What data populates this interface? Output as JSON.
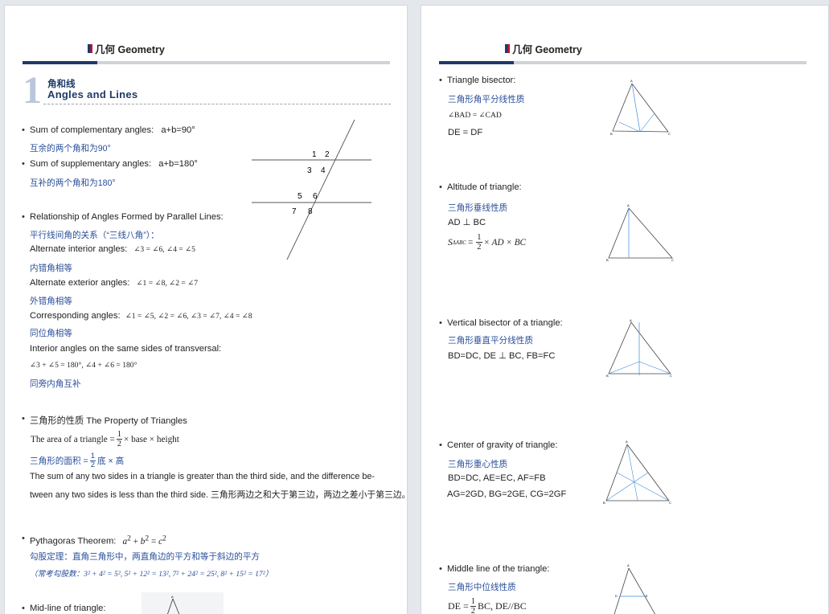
{
  "header": {
    "title": "几何 Geometry"
  },
  "left": {
    "section_number": "1",
    "section_title_cn": "角和线",
    "section_title_en": "Angles and Lines",
    "complementary": {
      "label": "Sum of complementary angles:",
      "formula": "a+b=90°",
      "cn": "互余的两个角和为90°"
    },
    "supplementary": {
      "label": "Sum of supplementary angles:",
      "formula": "a+b=180°",
      "cn": "互补的两个角和为180°"
    },
    "parallel": {
      "label": "Relationship of Angles Formed by Parallel Lines:",
      "cn": "平行线间角的关系（“三线八角”）：",
      "alt_interior_label": "Alternate interior angles:",
      "alt_interior_formula": "∠3 = ∠6, ∠4 = ∠5",
      "alt_interior_cn": "内错角相等",
      "alt_exterior_label": "Alternate exterior angles:",
      "alt_exterior_formula": "∠1 = ∠8, ∠2 = ∠7",
      "alt_exterior_cn": "外错角相等",
      "corresponding_label": "Corresponding angles:",
      "corresponding_formula": "∠1 = ∠5, ∠2 = ∠6, ∠3 = ∠7, ∠4 = ∠8",
      "corresponding_cn": "同位角相等",
      "interior_same_label": "Interior angles on the same sides of transversal:",
      "interior_same_formula": "∠3 + ∠5 = 180°, ∠4 + ∠6 = 180°",
      "interior_same_cn": "同旁内角互补",
      "angle_labels": [
        "1",
        "2",
        "3",
        "4",
        "5",
        "6",
        "7",
        "8"
      ]
    },
    "triangle_property": {
      "label": "三角形的性质 The Property of Triangles",
      "area_prefix": "The area of a triangle =",
      "area_num": "1",
      "area_den": "2",
      "area_suffix": "× base × height",
      "area_cn_prefix": "三角形的面积 =",
      "area_cn_num": "1",
      "area_cn_den": "2",
      "area_cn_suffix": "底 × 高",
      "sides_line1": "The sum of any two sides in a triangle is greater than the third side, and the difference be-",
      "sides_line2": "tween any two sides is less than the third side. 三角形两边之和大于第三边，两边之差小于第三边。"
    },
    "pythagoras": {
      "label": "Pythagoras Theorem:",
      "formula_a": "a",
      "formula_plus": " + ",
      "formula_b": "b",
      "formula_eq": " = ",
      "formula_c": "c",
      "exp": "2",
      "cn": "勾股定理：直角三角形中，两直角边的平方和等于斜边的平方",
      "examples": "（常考勾股数：3² + 4² = 5², 5² + 12² = 13², 7² + 24² = 25², 8² + 15² = 17²）"
    },
    "midline": {
      "label": "Mid-line of triangle:"
    }
  },
  "right": {
    "bisector": {
      "label": "Triangle bisector:",
      "cn": "三角形角平分线性质",
      "line1": "∠BAD = ∠CAD",
      "line2": "DE = DF"
    },
    "altitude": {
      "label": "Altitude of triangle:",
      "cn": "三角形垂线性质",
      "line1": "AD ⊥ BC",
      "area_lhs": "S",
      "area_sub": "ΔABC",
      "area_num": "1",
      "area_den": "2",
      "area_rhs": "× AD × BC"
    },
    "vertical_bisector": {
      "label": "Vertical bisector of a triangle:",
      "cn": "三角形垂直平分线性质",
      "line1": "BD=DC, DE ⊥ BC, FB=FC"
    },
    "gravity": {
      "label": "Center of gravity of triangle:",
      "cn": "三角形重心性质",
      "line1": "BD=DC, AE=EC, AF=FB",
      "line2": "AG=2GD, BG=2GE, CG=2GF"
    },
    "middle_line": {
      "label": "Middle line of the triangle:",
      "cn": "三角形中位线性质",
      "lhs": "DE =",
      "num": "1",
      "den": "2",
      "rhs": "BC, DE//BC"
    }
  },
  "colors": {
    "navy": "#1f3a68",
    "cn_blue": "#2a4f9a",
    "red": "#c8102e",
    "diagram_blue": "#3f8ad8"
  }
}
